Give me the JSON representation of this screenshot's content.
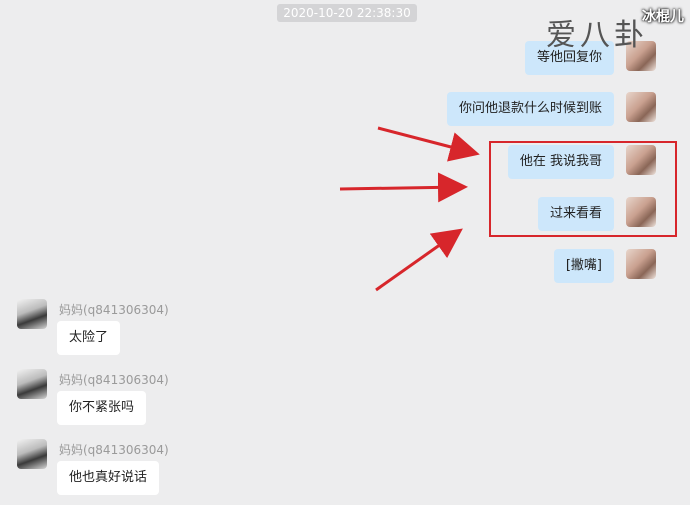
{
  "timestamp": "2020-10-20 22:38:30",
  "watermark": {
    "logo_text": "爱八卦",
    "corner_label": "冰棍儿"
  },
  "messages_out": [
    {
      "text": "等他回复你"
    },
    {
      "text": "你问他退款什么时候到账"
    },
    {
      "text": "他在 我说我哥"
    },
    {
      "text": "过来看看"
    },
    {
      "text": "[撇嘴]"
    }
  ],
  "messages_in": [
    {
      "sender": "妈妈(q841306304)",
      "text": "太险了"
    },
    {
      "sender": "妈妈(q841306304)",
      "text": "你不紧张吗"
    },
    {
      "sender": "妈妈(q841306304)",
      "text": "他也真好说话"
    }
  ],
  "annotation_color": "#d7262b"
}
